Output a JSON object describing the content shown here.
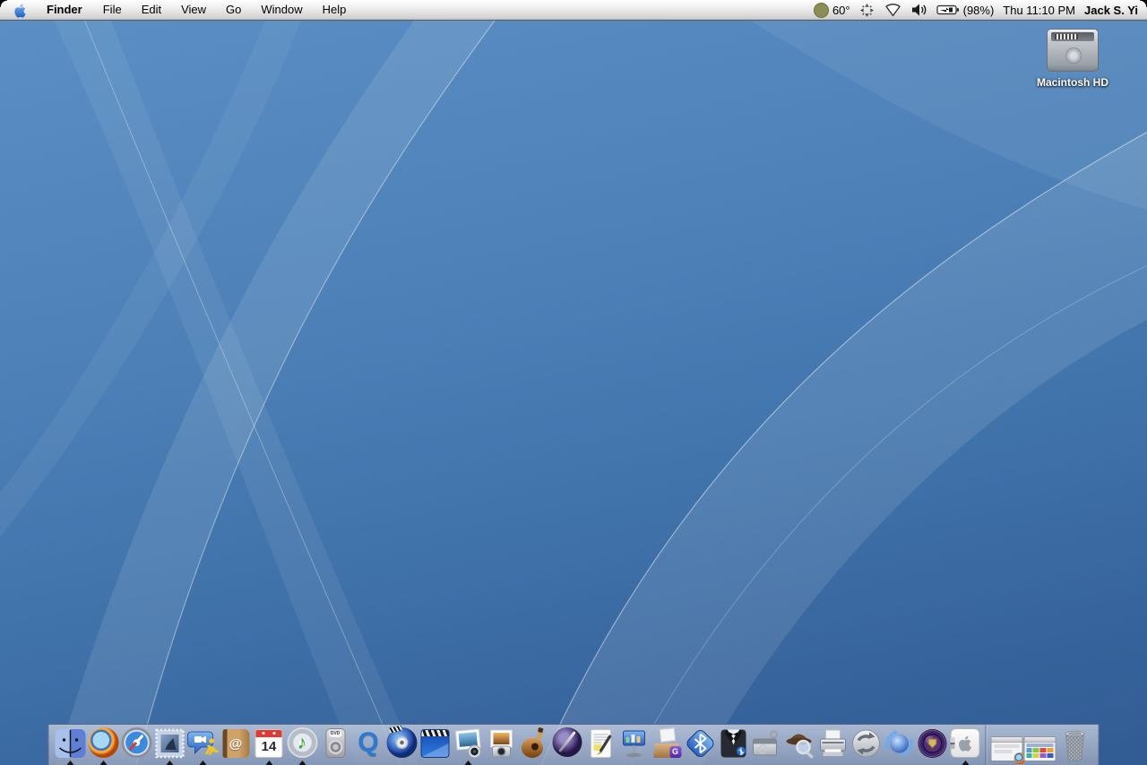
{
  "menu_bar": {
    "app_menu": "Finder",
    "menus": [
      "File",
      "Edit",
      "View",
      "Go",
      "Window",
      "Help"
    ],
    "status": {
      "weather_icon": "moon-circle-icon",
      "temperature": "60°",
      "status_icons": [
        "sparkle-sync-icon",
        "airport-no-signal-icon",
        "volume-icon",
        "battery-charging-icon"
      ],
      "battery": "(98%)",
      "clock": "Thu 11:10 PM",
      "user_name": "Jack S. Yi"
    }
  },
  "desktop": {
    "wallpaper": "aqua-blue-swirls",
    "volume_label": "Macintosh HD",
    "volume_icon": "internal-hard-drive-icon"
  },
  "dock": {
    "apps": [
      {
        "name": "finder",
        "running": true
      },
      {
        "name": "firefox",
        "running": true
      },
      {
        "name": "safari",
        "running": false
      },
      {
        "name": "mail",
        "running": true
      },
      {
        "name": "ichat",
        "running": true
      },
      {
        "name": "address-book",
        "running": false
      },
      {
        "name": "ical",
        "running": true
      },
      {
        "name": "itunes",
        "running": true
      },
      {
        "name": "dvd-player",
        "running": false
      },
      {
        "name": "quicktime-player",
        "running": false
      },
      {
        "name": "idvd",
        "running": false
      },
      {
        "name": "imovie",
        "running": false
      },
      {
        "name": "iphoto",
        "running": true
      },
      {
        "name": "image-capture",
        "running": false
      },
      {
        "name": "garageband",
        "running": false
      },
      {
        "name": "quill-orb-app",
        "running": false
      },
      {
        "name": "pages",
        "running": false
      },
      {
        "name": "keynote",
        "running": false
      },
      {
        "name": "gift-box-g-app",
        "running": false
      },
      {
        "name": "bluetooth-file-exchange",
        "running": false
      },
      {
        "name": "tuxedo-bluetooth-app",
        "running": false
      },
      {
        "name": "disk-utility",
        "running": false
      },
      {
        "name": "sherlock",
        "running": false
      },
      {
        "name": "printer-setup-utility",
        "running": false
      },
      {
        "name": "software-update",
        "running": false
      },
      {
        "name": "sync-globe-app",
        "running": false
      },
      {
        "name": "purple-orb-shield-app",
        "running": false
      },
      {
        "name": "system-preferences",
        "running": true
      }
    ],
    "ical_date": "14",
    "minimized_windows": [
      {
        "name": "firefox-page-window",
        "badge": "firefox"
      },
      {
        "name": "colorful-grid-window"
      }
    ],
    "trash_state": "empty"
  },
  "glyphs": {
    "quicktime_q": "Q",
    "music_note": "♪",
    "at_symbol": "@",
    "g_badge": "G",
    "dvd_label": "DVD"
  },
  "colors": {
    "wallpaper_top": "#5a8ec4",
    "wallpaper_bottom": "#315b93",
    "menubar_bg": "#e8e8e8",
    "dock_shelf": "rgba(175,186,208,0.8)",
    "ical_red": "#e23a30",
    "running_indicator": "#141414"
  }
}
